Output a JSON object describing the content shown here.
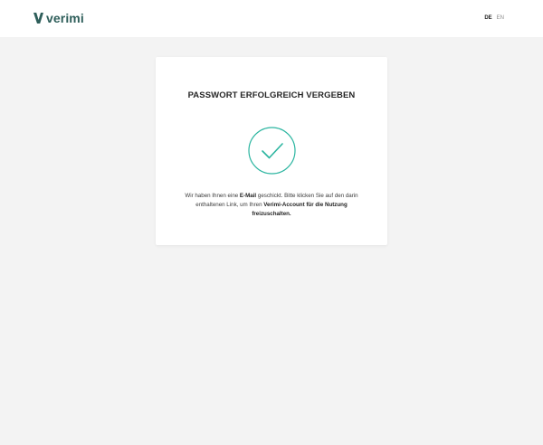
{
  "header": {
    "logo_text": "verimi",
    "languages": [
      {
        "code": "DE",
        "active": true
      },
      {
        "code": "EN",
        "active": false
      }
    ]
  },
  "card": {
    "title": "PASSWORT ERFOLGREICH VERGEBEN",
    "icon": "checkmark-circle-icon",
    "message": {
      "part1": "Wir haben Ihnen eine ",
      "bold1": "E-Mail",
      "part2": " geschickt. Bitte klicken Sie auf den darin enthaltenen Link, um Ihren ",
      "bold2": "Verimi-Account für die Nutzung freizuschalten."
    }
  },
  "colors": {
    "brand": "#2e5e5a",
    "accent": "#2bb5a0",
    "background": "#f3f3f3"
  }
}
